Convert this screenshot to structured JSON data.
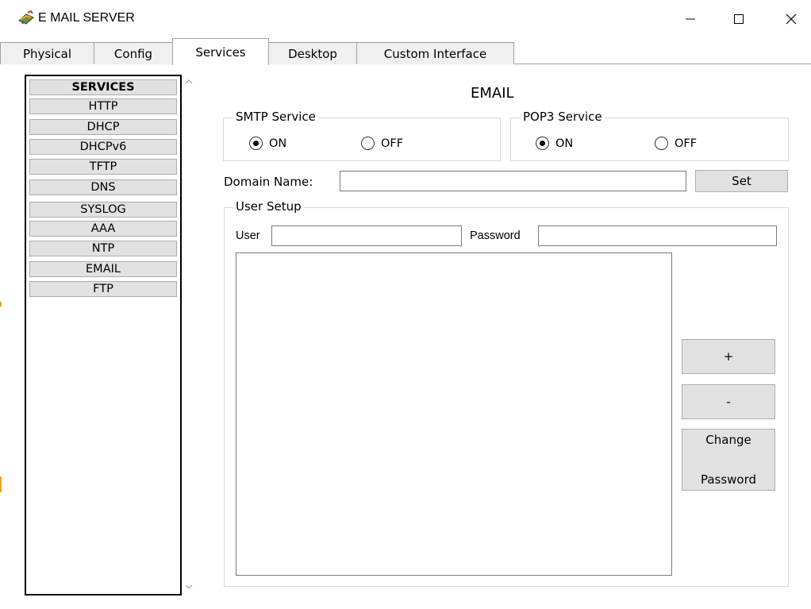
{
  "window": {
    "title": "E MAIL SERVER",
    "icon": "packet-tracer-server-icon",
    "controls": {
      "minimize": "—",
      "maximize": "☐",
      "close": "✕"
    }
  },
  "tabs": [
    {
      "label": "Physical",
      "active": false
    },
    {
      "label": "Config",
      "active": false
    },
    {
      "label": "Services",
      "active": true
    },
    {
      "label": "Desktop",
      "active": false
    },
    {
      "label": "Custom Interface",
      "active": false
    }
  ],
  "services": {
    "header": "SERVICES",
    "items": [
      "HTTP",
      "DHCP",
      "DHCPv6",
      "TFTP",
      "DNS",
      "SYSLOG",
      "AAA",
      "NTP",
      "EMAIL",
      "FTP"
    ]
  },
  "email": {
    "title": "EMAIL",
    "smtp": {
      "label": "SMTP Service",
      "on_label": "ON",
      "off_label": "OFF",
      "selected": "ON"
    },
    "pop3": {
      "label": "POP3 Service",
      "on_label": "ON",
      "off_label": "OFF",
      "selected": "ON"
    },
    "domain": {
      "label": "Domain Name:",
      "value": "",
      "set_button": "Set"
    },
    "user_setup": {
      "label": "User Setup",
      "user_label": "User",
      "user_value": "",
      "password_label": "Password",
      "password_value": "",
      "users": [],
      "add_button": "+",
      "remove_button": "-",
      "change_button_line1": "Change",
      "change_button_line2": "Password"
    }
  },
  "colors": {
    "accent": "#e6a52a",
    "button_bg": "#e1e1e1",
    "border": "#adadad"
  }
}
